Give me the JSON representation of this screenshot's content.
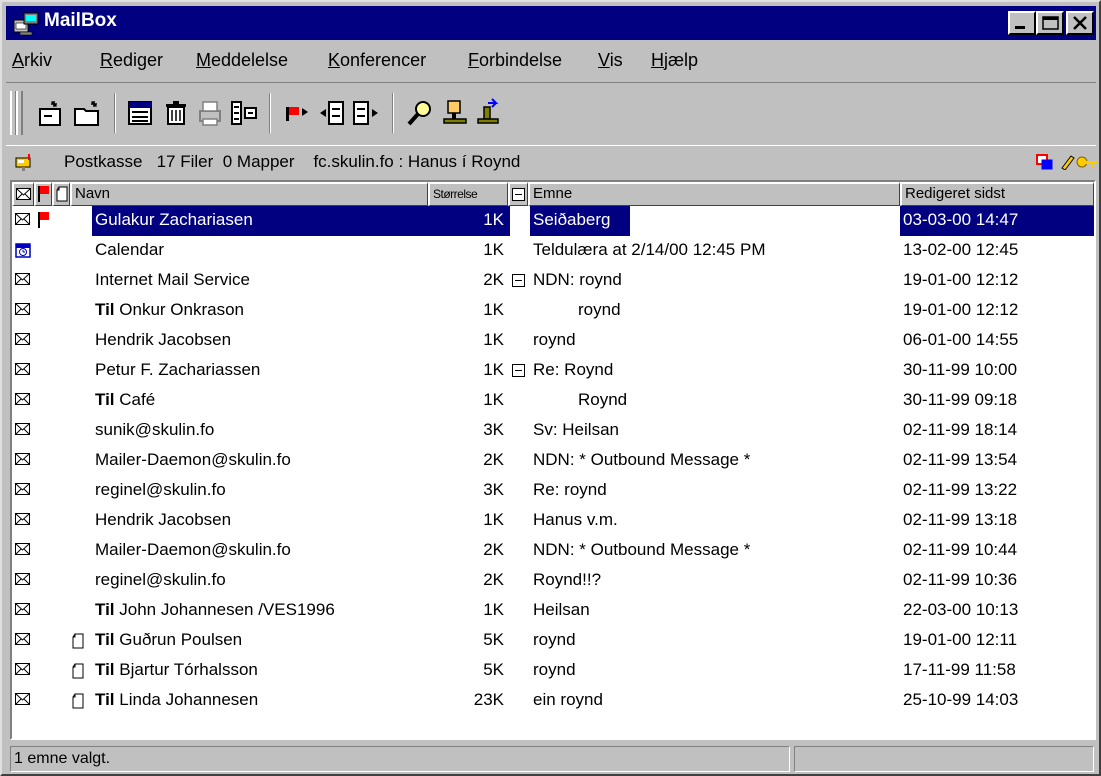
{
  "window": {
    "title": "MailBox"
  },
  "menu": {
    "items": [
      {
        "pre": "",
        "u": "A",
        "post": "rkiv"
      },
      {
        "pre": "",
        "u": "R",
        "post": "ediger"
      },
      {
        "pre": "",
        "u": "M",
        "post": "eddelelse"
      },
      {
        "pre": "",
        "u": "K",
        "post": "onferencer"
      },
      {
        "pre": "",
        "u": "F",
        "post": "orbindelse"
      },
      {
        "pre": "",
        "u": "V",
        "post": "is"
      },
      {
        "pre": "",
        "u": "H",
        "post": "jælp"
      }
    ]
  },
  "toolbar": {
    "icons": [
      "new-message-icon",
      "open-folder-icon",
      "message-list-icon",
      "delete-icon",
      "print-icon",
      "properties-icon",
      "flag-next-icon",
      "previous-message-icon",
      "next-message-icon",
      "search-icon",
      "address-book-icon",
      "connect-icon"
    ]
  },
  "pathbar": {
    "text": "Postkasse   17 Filer  0 Mapper    fc.skulin.fo : Hanus í Roynd"
  },
  "list": {
    "headers": {
      "name": "Navn",
      "size": "Størrelse",
      "subject": "Emne",
      "modified": "Redigeret sidst"
    },
    "rows": [
      {
        "icon": "envelope",
        "flag": true,
        "note": false,
        "prefix": "",
        "name": "Gulakur Zachariasen",
        "size": "1K",
        "tree": false,
        "indent": false,
        "subject": "Seiðaberg",
        "date": "03-03-00 14:47",
        "selected": true
      },
      {
        "icon": "calendar",
        "flag": false,
        "note": false,
        "prefix": "",
        "name": "Calendar",
        "size": "1K",
        "tree": false,
        "indent": false,
        "subject": "Teldulæra at 2/14/00 12:45 PM",
        "date": "13-02-00 12:45",
        "selected": false
      },
      {
        "icon": "envelope",
        "flag": false,
        "note": false,
        "prefix": "",
        "name": "Internet Mail Service",
        "size": "2K",
        "tree": true,
        "indent": false,
        "subject": "NDN: roynd",
        "date": "19-01-00 12:12",
        "selected": false
      },
      {
        "icon": "envelope",
        "flag": false,
        "note": false,
        "prefix": "Til",
        "name": "Onkur Onkrason",
        "size": "1K",
        "tree": false,
        "indent": true,
        "subject": "roynd",
        "date": "19-01-00 12:12",
        "selected": false
      },
      {
        "icon": "envelope",
        "flag": false,
        "note": false,
        "prefix": "",
        "name": "Hendrik Jacobsen",
        "size": "1K",
        "tree": false,
        "indent": false,
        "subject": "roynd",
        "date": "06-01-00 14:55",
        "selected": false
      },
      {
        "icon": "envelope",
        "flag": false,
        "note": false,
        "prefix": "",
        "name": "Petur F. Zachariassen",
        "size": "1K",
        "tree": true,
        "indent": false,
        "subject": "Re: Roynd",
        "date": "30-11-99 10:00",
        "selected": false
      },
      {
        "icon": "envelope",
        "flag": false,
        "note": false,
        "prefix": "Til",
        "name": "Café",
        "size": "1K",
        "tree": false,
        "indent": true,
        "subject": "Roynd",
        "date": "30-11-99 09:18",
        "selected": false
      },
      {
        "icon": "envelope",
        "flag": false,
        "note": false,
        "prefix": "",
        "name": "sunik@skulin.fo",
        "size": "3K",
        "tree": false,
        "indent": false,
        "subject": "Sv: Heilsan",
        "date": "02-11-99 18:14",
        "selected": false
      },
      {
        "icon": "envelope",
        "flag": false,
        "note": false,
        "prefix": "",
        "name": "Mailer-Daemon@skulin.fo",
        "size": "2K",
        "tree": false,
        "indent": false,
        "subject": "NDN: * Outbound Message *",
        "date": "02-11-99 13:54",
        "selected": false
      },
      {
        "icon": "envelope",
        "flag": false,
        "note": false,
        "prefix": "",
        "name": "reginel@skulin.fo",
        "size": "3K",
        "tree": false,
        "indent": false,
        "subject": "Re: roynd",
        "date": "02-11-99 13:22",
        "selected": false
      },
      {
        "icon": "envelope",
        "flag": false,
        "note": false,
        "prefix": "",
        "name": "Hendrik Jacobsen",
        "size": "1K",
        "tree": false,
        "indent": false,
        "subject": "Hanus v.m.",
        "date": "02-11-99 13:18",
        "selected": false
      },
      {
        "icon": "envelope",
        "flag": false,
        "note": false,
        "prefix": "",
        "name": "Mailer-Daemon@skulin.fo",
        "size": "2K",
        "tree": false,
        "indent": false,
        "subject": "NDN: * Outbound Message *",
        "date": "02-11-99 10:44",
        "selected": false
      },
      {
        "icon": "envelope",
        "flag": false,
        "note": false,
        "prefix": "",
        "name": "reginel@skulin.fo",
        "size": "2K",
        "tree": false,
        "indent": false,
        "subject": "Roynd!!?",
        "date": "02-11-99 10:36",
        "selected": false
      },
      {
        "icon": "envelope",
        "flag": false,
        "note": false,
        "prefix": "Til",
        "name": "John Johannesen /VES1996",
        "size": "1K",
        "tree": false,
        "indent": false,
        "subject": "Heilsan",
        "date": "22-03-00 10:13",
        "selected": false
      },
      {
        "icon": "envelope",
        "flag": false,
        "note": true,
        "prefix": "Til",
        "name": "Guðrun Poulsen",
        "size": "5K",
        "tree": false,
        "indent": false,
        "subject": "roynd",
        "date": "19-01-00 12:11",
        "selected": false
      },
      {
        "icon": "envelope",
        "flag": false,
        "note": true,
        "prefix": "Til",
        "name": "Bjartur Tórhalsson",
        "size": "5K",
        "tree": false,
        "indent": false,
        "subject": "roynd",
        "date": "17-11-99 11:58",
        "selected": false
      },
      {
        "icon": "envelope",
        "flag": false,
        "note": true,
        "prefix": "Til",
        "name": "Linda Johannesen",
        "size": "23K",
        "tree": false,
        "indent": false,
        "subject": "ein roynd",
        "date": "25-10-99 14:03",
        "selected": false
      }
    ]
  },
  "status": {
    "text": "1 emne valgt.",
    "secondary": ""
  },
  "colors": {
    "titlebar": "#000080",
    "selection": "#000080",
    "face": "#c0c0c0",
    "flag": "#ff0000"
  }
}
